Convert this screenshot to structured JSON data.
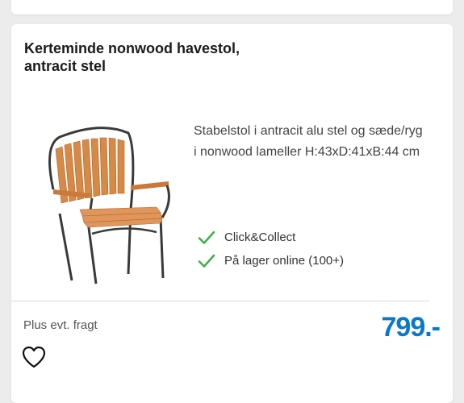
{
  "product": {
    "title_line1": "Kerteminde nonwood havestol,",
    "title_line2": "antracit stel",
    "description_line1": "Stabelstol i antracit alu stel og sæde/ryg",
    "description_line2": "i nonwood lameller H:43xD:41xB:44 cm",
    "image_icon": "chair-image",
    "availability": [
      {
        "label": "Click&Collect",
        "icon": "check-icon"
      },
      {
        "label": "På lager online (100+)",
        "icon": "check-icon"
      }
    ],
    "freight_note": "Plus evt. fragt",
    "price": "799.-",
    "favorite_icon": "heart-icon"
  },
  "colors": {
    "price": "#0a77cf",
    "check": "#3cb043",
    "background": "#ececec"
  }
}
